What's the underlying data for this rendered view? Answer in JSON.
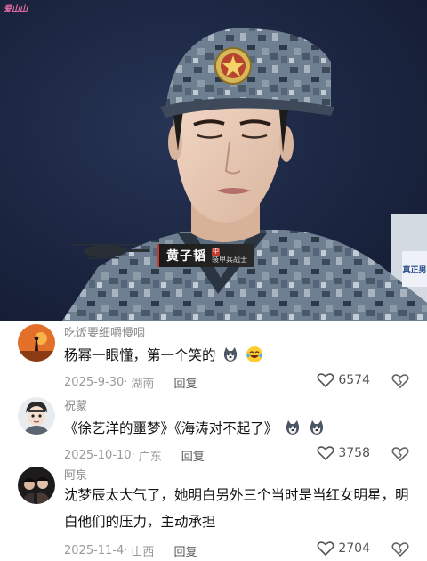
{
  "video": {
    "watermark": "爱山山",
    "lower_third": {
      "name": "黄子韬",
      "tag": "中",
      "title": "装甲兵战士"
    },
    "corner_logo": "真正男",
    "colors": {
      "backdrop": "#1b2540",
      "camo": "#5a6a7e",
      "banner_accent": "#c23b30"
    }
  },
  "comments": [
    {
      "username": "吃饭要细嚼慢咽",
      "text": "杨幂一眼懂，第一个笑的",
      "emojis": [
        "husky-dog-emoji",
        "laughing-tears-emoji"
      ],
      "date": "2025-9-30",
      "location": "湖南",
      "reply_label": "回复",
      "likes": "6574",
      "avatar": "sunset-silhouette-avatar"
    },
    {
      "username": "祝蒙",
      "text": "《徐艺洋的噩梦》《海涛对不起了》",
      "emojis": [
        "husky-dog-emoji",
        "husky-dog-emoji"
      ],
      "date": "2025-10-10",
      "location": "广东",
      "reply_label": "回复",
      "likes": "3758",
      "avatar": "cartoon-boy-avatar"
    },
    {
      "username": "阿泉",
      "text": "沈梦辰太大气了，她明白另外三个当时是当红女明星，明白他们的压力，主动承担",
      "emojis": [],
      "date": "2025-11-4",
      "location": "山西",
      "reply_label": "回复",
      "likes": "2704",
      "avatar": "group-photo-avatar"
    }
  ]
}
